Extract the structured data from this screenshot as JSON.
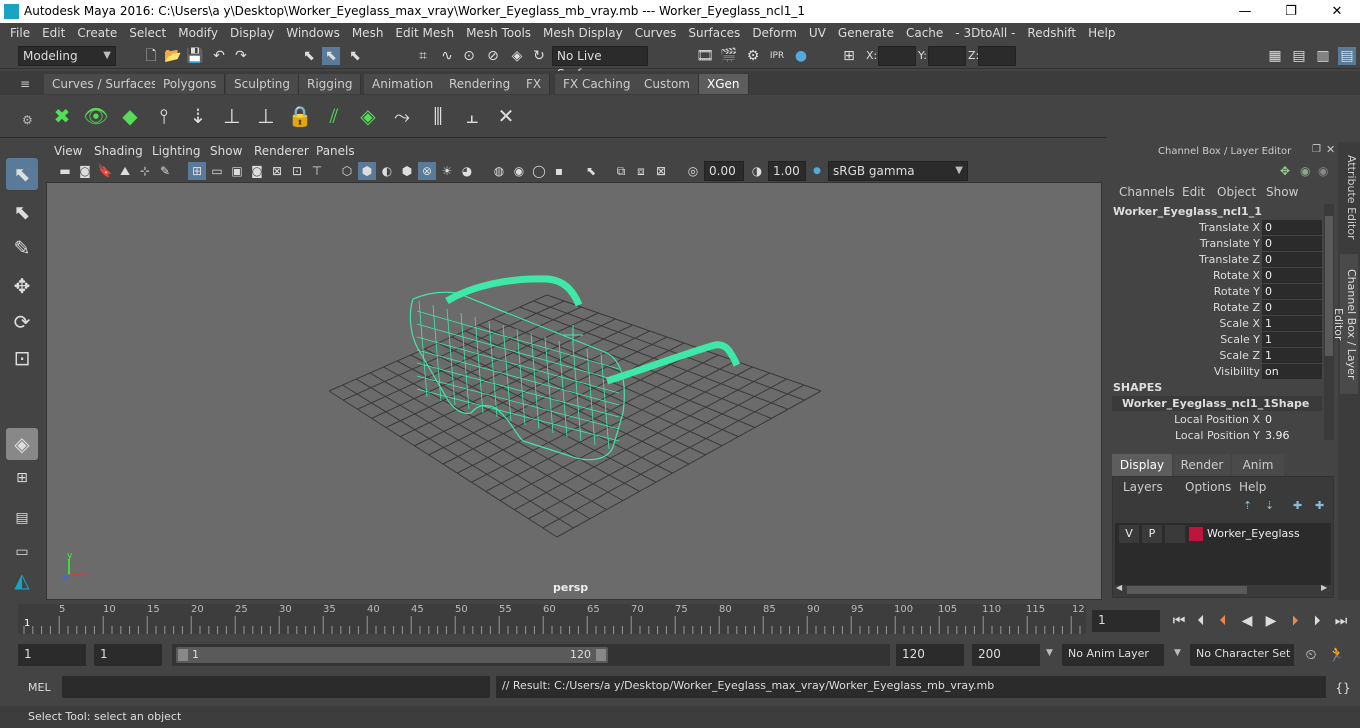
{
  "window": {
    "title": "Autodesk Maya 2016: C:\\Users\\a y\\Desktop\\Worker_Eyeglass_max_vray\\Worker_Eyeglass_mb_vray.mb   ---   Worker_Eyeglass_ncl1_1",
    "minimize": "—",
    "maximize": "❐",
    "close": "✕"
  },
  "menu": [
    "File",
    "Edit",
    "Create",
    "Select",
    "Modify",
    "Display",
    "Windows",
    "Mesh",
    "Edit Mesh",
    "Mesh Tools",
    "Mesh Display",
    "Curves",
    "Surfaces",
    "Deform",
    "UV",
    "Generate",
    "Cache",
    "- 3DtoAll -",
    "Redshift",
    "Help"
  ],
  "status": {
    "mode": "Modeling",
    "live_surface": "No Live Surface",
    "x_label": "X:",
    "y_label": "Y:",
    "z_label": "Z:"
  },
  "shelf_tabs": [
    "Curves / Surfaces",
    "Polygons",
    "Sculpting",
    "Rigging",
    "Animation",
    "Rendering",
    "FX",
    "FX Caching",
    "Custom",
    "XGen"
  ],
  "shelf_active": "XGen",
  "viewport": {
    "menu": [
      "View",
      "Shading",
      "Lighting",
      "Show",
      "Renderer",
      "Panels"
    ],
    "near": "0.00",
    "far": "1.00",
    "colorspace": "sRGB gamma",
    "camera": "persp",
    "axis_y": "y",
    "axis_z": "z",
    "wire_color": "#3fe8a8"
  },
  "channel_box": {
    "title": "Channel Box / Layer Editor",
    "menu": [
      "Channels",
      "Edit",
      "Object",
      "Show"
    ],
    "object": "Worker_Eyeglass_ncl1_1",
    "attrs": [
      {
        "name": "Translate X",
        "value": "0"
      },
      {
        "name": "Translate Y",
        "value": "0"
      },
      {
        "name": "Translate Z",
        "value": "0"
      },
      {
        "name": "Rotate X",
        "value": "0"
      },
      {
        "name": "Rotate Y",
        "value": "0"
      },
      {
        "name": "Rotate Z",
        "value": "0"
      },
      {
        "name": "Scale X",
        "value": "1"
      },
      {
        "name": "Scale Y",
        "value": "1"
      },
      {
        "name": "Scale Z",
        "value": "1"
      },
      {
        "name": "Visibility",
        "value": "on"
      }
    ],
    "shapes_header": "SHAPES",
    "shape_name": "Worker_Eyeglass_ncl1_1Shape",
    "shape_attrs": [
      {
        "name": "Local Position X",
        "value": "0"
      },
      {
        "name": "Local Position Y",
        "value": "3.96"
      }
    ]
  },
  "layer_editor": {
    "tabs": [
      "Display",
      "Render",
      "Anim"
    ],
    "menu": [
      "Layers",
      "Options",
      "Help"
    ],
    "layer": {
      "v": "V",
      "p": "P",
      "name": "Worker_Eyeglass",
      "color": "#c0143c"
    }
  },
  "side_tabs": [
    "Attribute Editor",
    "Channel Box / Layer Editor"
  ],
  "timeline": {
    "ticks": [
      "5",
      "10",
      "15",
      "20",
      "25",
      "30",
      "35",
      "40",
      "45",
      "50",
      "55",
      "60",
      "65",
      "70",
      "75",
      "80",
      "85",
      "90",
      "95",
      "100",
      "105",
      "110",
      "115",
      "12"
    ],
    "current_marker": "1",
    "current_frame": "1"
  },
  "range": {
    "start": "1",
    "playback_start": "1",
    "slider_start": "1",
    "slider_end": "120",
    "playback_end": "120",
    "end": "200",
    "anim_layer": "No Anim Layer",
    "char_set": "No Character Set"
  },
  "mel": {
    "label": "MEL",
    "result": "// Result: C:/Users/a y/Desktop/Worker_Eyeglass_max_vray/Worker_Eyeglass_mb_vray.mb"
  },
  "help_line": "Select Tool: select an object"
}
